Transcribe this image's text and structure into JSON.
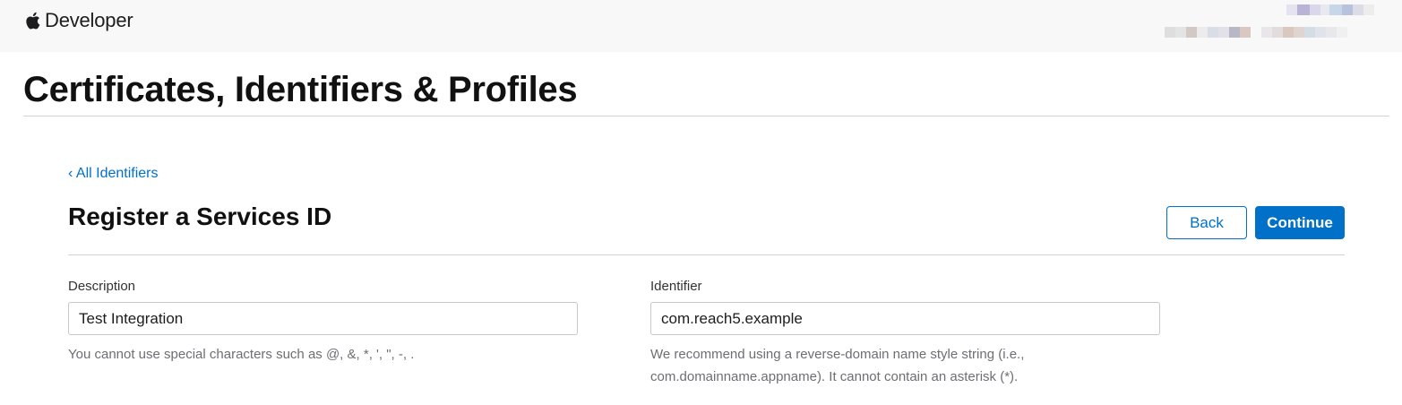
{
  "header": {
    "brand_text": "Developer",
    "logo_icon": "apple-logo-icon"
  },
  "page": {
    "title": "Certificates, Identifiers & Profiles"
  },
  "nav": {
    "back_link": "‹ All Identifiers"
  },
  "form": {
    "title": "Register a Services ID",
    "back_label": "Back",
    "continue_label": "Continue",
    "description": {
      "label": "Description",
      "value": "Test Integration",
      "help": "You cannot use special characters such as @, &, *, ', \", -, ."
    },
    "identifier": {
      "label": "Identifier",
      "value": "com.reach5.example",
      "help_line1": "We recommend using a reverse-domain name style string (i.e.,",
      "help_line2": "com.domainname.appname). It cannot contain an asterisk (*)."
    }
  },
  "colors": {
    "accent": "#0070c9",
    "header_bg": "#f8f8f8",
    "rule": "#d2d2d7"
  }
}
